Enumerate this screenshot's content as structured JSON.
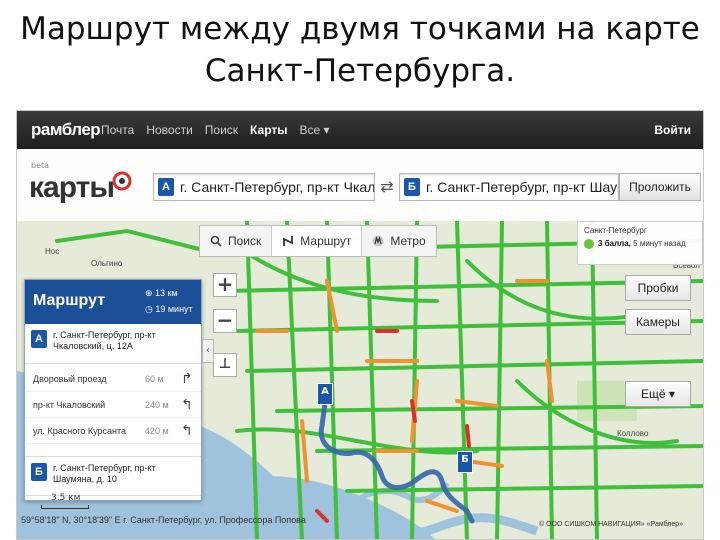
{
  "slide": {
    "title_line1": "Маршрут между двумя точками на карте",
    "title_line2": "Санкт-Петербурга."
  },
  "topbar": {
    "logo": "рамблер",
    "nav": [
      "Почта",
      "Новости",
      "Поиск",
      "Карты",
      "Все ▾"
    ],
    "active_nav": "Карты",
    "login": "Войти"
  },
  "header": {
    "beta": "beta",
    "brand": "карты",
    "from": {
      "pin": "А",
      "value": "г. Санкт-Петербург, пр-кт Чкалов"
    },
    "swap": "⇄",
    "to": {
      "pin": "Б",
      "value": "г. Санкт-Петербург, пр-кт Шаумя"
    },
    "route_button": "Проложить"
  },
  "tabs": [
    {
      "label": "Поиск",
      "icon": "search-icon"
    },
    {
      "label": "Маршрут",
      "icon": "route-icon"
    },
    {
      "label": "Метро",
      "icon": "metro-icon"
    }
  ],
  "traffic": {
    "city": "Санкт-Петербург",
    "score": "3 балла,",
    "updated": "5 минут назад",
    "color": "#69c43c"
  },
  "side_buttons": {
    "traffic": "Пробки",
    "cameras": "Камеры",
    "more": "Ещё ▾"
  },
  "zoom": {
    "plus": "+",
    "minus": "−",
    "level": "⊥"
  },
  "panel": {
    "title": "Маршрут",
    "distance": "13 км",
    "duration": "19 минут",
    "start": {
      "pin": "А",
      "address": "г. Санкт-Петербург, пр-кт Чкаловский, ц. 12А"
    },
    "steps": [
      {
        "label": "Дворовый проезд",
        "length": "60 м",
        "arrow": "↱"
      },
      {
        "label": "пр-кт Чкаловский",
        "length": "240 м",
        "arrow": "↰"
      },
      {
        "label": "ул. Красного Курсанта",
        "length": "420 м",
        "arrow": "↰"
      }
    ],
    "end": {
      "pin": "Б",
      "address": "г. Санкт-Петербург, пр-кт Шаумяна, д. 10"
    },
    "collapse": "‹"
  },
  "map_labels": {
    "place1": "Нос",
    "place2": "Ольгино",
    "place3": "Всевол",
    "place4": "Коллово",
    "marker_a": "А",
    "marker_b": "Б"
  },
  "status": {
    "scale": "3.5 км",
    "coords": "59°58'18\" N, 30°18'39\" E   г. Санкт-Петербург, ул. Профессора Попова",
    "copyright": "© OOO СИШКОМ НАВИГАЦИЯ» «Рамблер»"
  }
}
